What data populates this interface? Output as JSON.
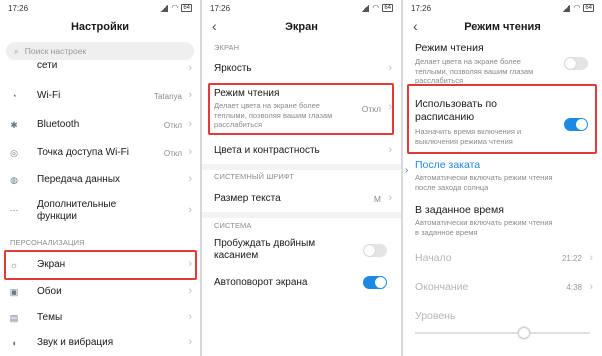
{
  "status_time": "17:26",
  "battery": "64",
  "screen1": {
    "title": "Настройки",
    "search_placeholder": "Поиск настроек",
    "partial_row": "сети",
    "rows": [
      {
        "label": "Wi-Fi",
        "value": "Tatanya",
        "icon": "wifi-icon"
      },
      {
        "label": "Bluetooth",
        "value": "Откл",
        "icon": "bluetooth-icon"
      },
      {
        "label": "Точка доступа Wi-Fi",
        "value": "Откл",
        "icon": "hotspot-icon"
      },
      {
        "label": "Передача данных",
        "value": "",
        "icon": "data-usage-icon"
      },
      {
        "label": "Дополнительные функции",
        "value": "",
        "icon": "more-icon"
      }
    ],
    "section": "ПЕРСОНАЛИЗАЦИЯ",
    "rows2": [
      {
        "label": "Экран",
        "icon": "brightness-icon"
      },
      {
        "label": "Обои",
        "icon": "wallpaper-icon"
      },
      {
        "label": "Темы",
        "icon": "themes-icon"
      },
      {
        "label": "Звук и вибрация",
        "icon": "sound-icon"
      }
    ]
  },
  "screen2": {
    "title": "Экран",
    "section1": "ЭКРАН",
    "brightness": "Яркость",
    "reading_mode": "Режим чтения",
    "reading_mode_desc": "Делает цвета на экране более теплыми, позволяя вашим глазам расслабиться",
    "reading_mode_value": "Откл",
    "colors": "Цвета и контрастность",
    "section2": "СИСТЕМНЫЙ ШРИФТ",
    "font_size": "Размер текста",
    "font_size_value": "M",
    "section3": "СИСТЕМА",
    "double_tap": "Пробуждать двойным касанием",
    "double_tap_on": false,
    "autorotate": "Автоповорот экрана",
    "autorotate_on": true
  },
  "screen3": {
    "title": "Режим чтения",
    "reading_mode": "Режим чтения",
    "reading_mode_desc": "Делает цвета на экране более теплыми, позволяя вашим глазам расслабиться",
    "reading_mode_on": false,
    "schedule": "Использовать по расписанию",
    "schedule_desc": "Назначить время включения и выключения режима чтения",
    "schedule_on": true,
    "after_sunset": "После заката",
    "after_sunset_desc": "Автоматически включать режим чтения после захода солнца",
    "custom_time": "В заданное время",
    "custom_time_desc": "Автоматически включать режим чтения в заданное время",
    "start": "Начало",
    "start_value": "21:22",
    "end": "Окончание",
    "end_value": "4:38",
    "level": "Уровень",
    "level_fraction": 0.62,
    "accent": "#1e88e5",
    "highlight": "#e53935"
  }
}
